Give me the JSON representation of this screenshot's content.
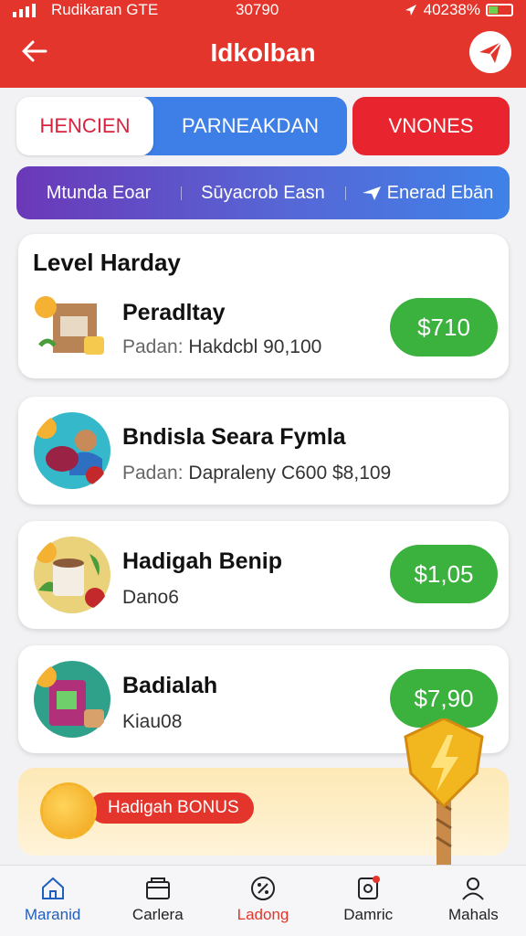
{
  "status": {
    "carrier": "Rudikaran GTE",
    "time": "30790",
    "battery": "40238%"
  },
  "header": {
    "title": "Idkolban"
  },
  "tabs": [
    {
      "label": "HENCIEN"
    },
    {
      "label": "PARNEAKDAN"
    },
    {
      "label": "VNONES"
    }
  ],
  "filters": [
    {
      "label": "Mtunda Eoar"
    },
    {
      "label": "Sūyacrob Easn"
    },
    {
      "label": "Enerad Ebān"
    }
  ],
  "section": {
    "title": "Level Harday"
  },
  "items": [
    {
      "title": "Peradltay",
      "sub_label": "Padan:",
      "sub_value": "Hakdcbl 90,100",
      "price": "$710"
    },
    {
      "title": "Bndisla Seara Fymla",
      "sub_label": "Padan:",
      "sub_value": "Dapraleny C600  $8,109",
      "price": ""
    },
    {
      "title": "Hadigah Benip",
      "sub_label": "",
      "sub_value": "Dano6",
      "price": "$1,05"
    },
    {
      "title": "Badialah",
      "sub_label": "",
      "sub_value": "Kiau08",
      "price": "$7,90"
    }
  ],
  "bonus": {
    "label": "Hadigah BONUS"
  },
  "nav": [
    {
      "label": "Maranid",
      "icon": "home-icon"
    },
    {
      "label": "Carlera",
      "icon": "wallet-icon"
    },
    {
      "label": "Ladong",
      "icon": "discount-icon"
    },
    {
      "label": "Damric",
      "icon": "notification-icon"
    },
    {
      "label": "Mahals",
      "icon": "profile-icon"
    }
  ],
  "colors": {
    "header": "#e3352c",
    "blue": "#3d7fe6",
    "green": "#3bb13e",
    "purple": "#6b38b8"
  }
}
